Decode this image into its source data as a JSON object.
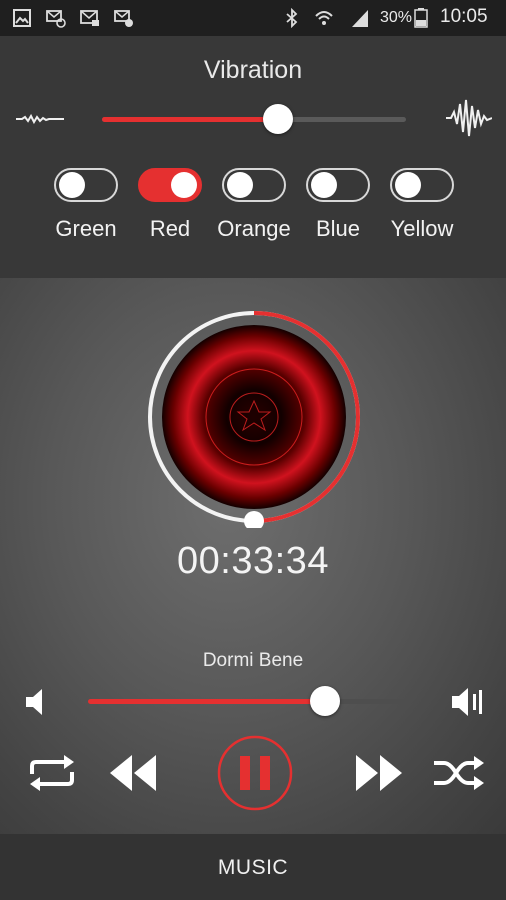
{
  "status_bar": {
    "battery": "30%",
    "time": "10:05",
    "icons": [
      "image-icon",
      "mail-sync-icon",
      "mail-icon",
      "mail-alert-icon",
      "bluetooth-icon",
      "wifi-icon",
      "signal-icon",
      "battery-icon"
    ]
  },
  "vibration": {
    "title": "Vibration",
    "level": 0.58,
    "icons": {
      "low": "small-wave-icon",
      "high": "large-wave-icon"
    }
  },
  "colors": {
    "accent": "#e53030",
    "items": [
      {
        "label": "Green",
        "on": false
      },
      {
        "label": "Red",
        "on": true
      },
      {
        "label": "Orange",
        "on": false
      },
      {
        "label": "Blue",
        "on": false
      },
      {
        "label": "Yellow",
        "on": false
      }
    ]
  },
  "player": {
    "elapsed": "00:33:34",
    "progress": 0.5,
    "track_title": "Dormi Bene",
    "volume": 0.74,
    "is_playing": true
  },
  "controls": [
    "repeat-icon",
    "rewind-icon",
    "pause-icon",
    "fast-forward-icon",
    "shuffle-icon"
  ],
  "bottom_nav": {
    "label": "MUSIC"
  }
}
